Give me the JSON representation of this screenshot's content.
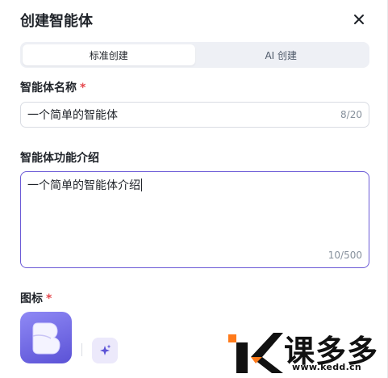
{
  "dialog": {
    "title": "创建智能体"
  },
  "tabs": [
    {
      "label": "标准创建",
      "active": true
    },
    {
      "label": "AI 创建",
      "active": false
    }
  ],
  "name_field": {
    "label": "智能体名称",
    "required_mark": "*",
    "value": "一个简单的智能体",
    "count": "8/20"
  },
  "intro_field": {
    "label": "智能体功能介绍",
    "value": "一个简单的智能体介绍",
    "count": "10/500"
  },
  "icon_field": {
    "label": "图标",
    "required_mark": "*",
    "avatar_icon": "bot-avatar-icon",
    "magic_icon": "sparkle-icon"
  },
  "watermark": {
    "brand": "课多多",
    "url": "www.kedd.cn"
  },
  "colors": {
    "accent": "#6b5ad6",
    "required": "#e5484d",
    "avatar_start": "#8f89f5",
    "avatar_end": "#5b52d6",
    "watermark_orange": "#ff7a1a"
  }
}
